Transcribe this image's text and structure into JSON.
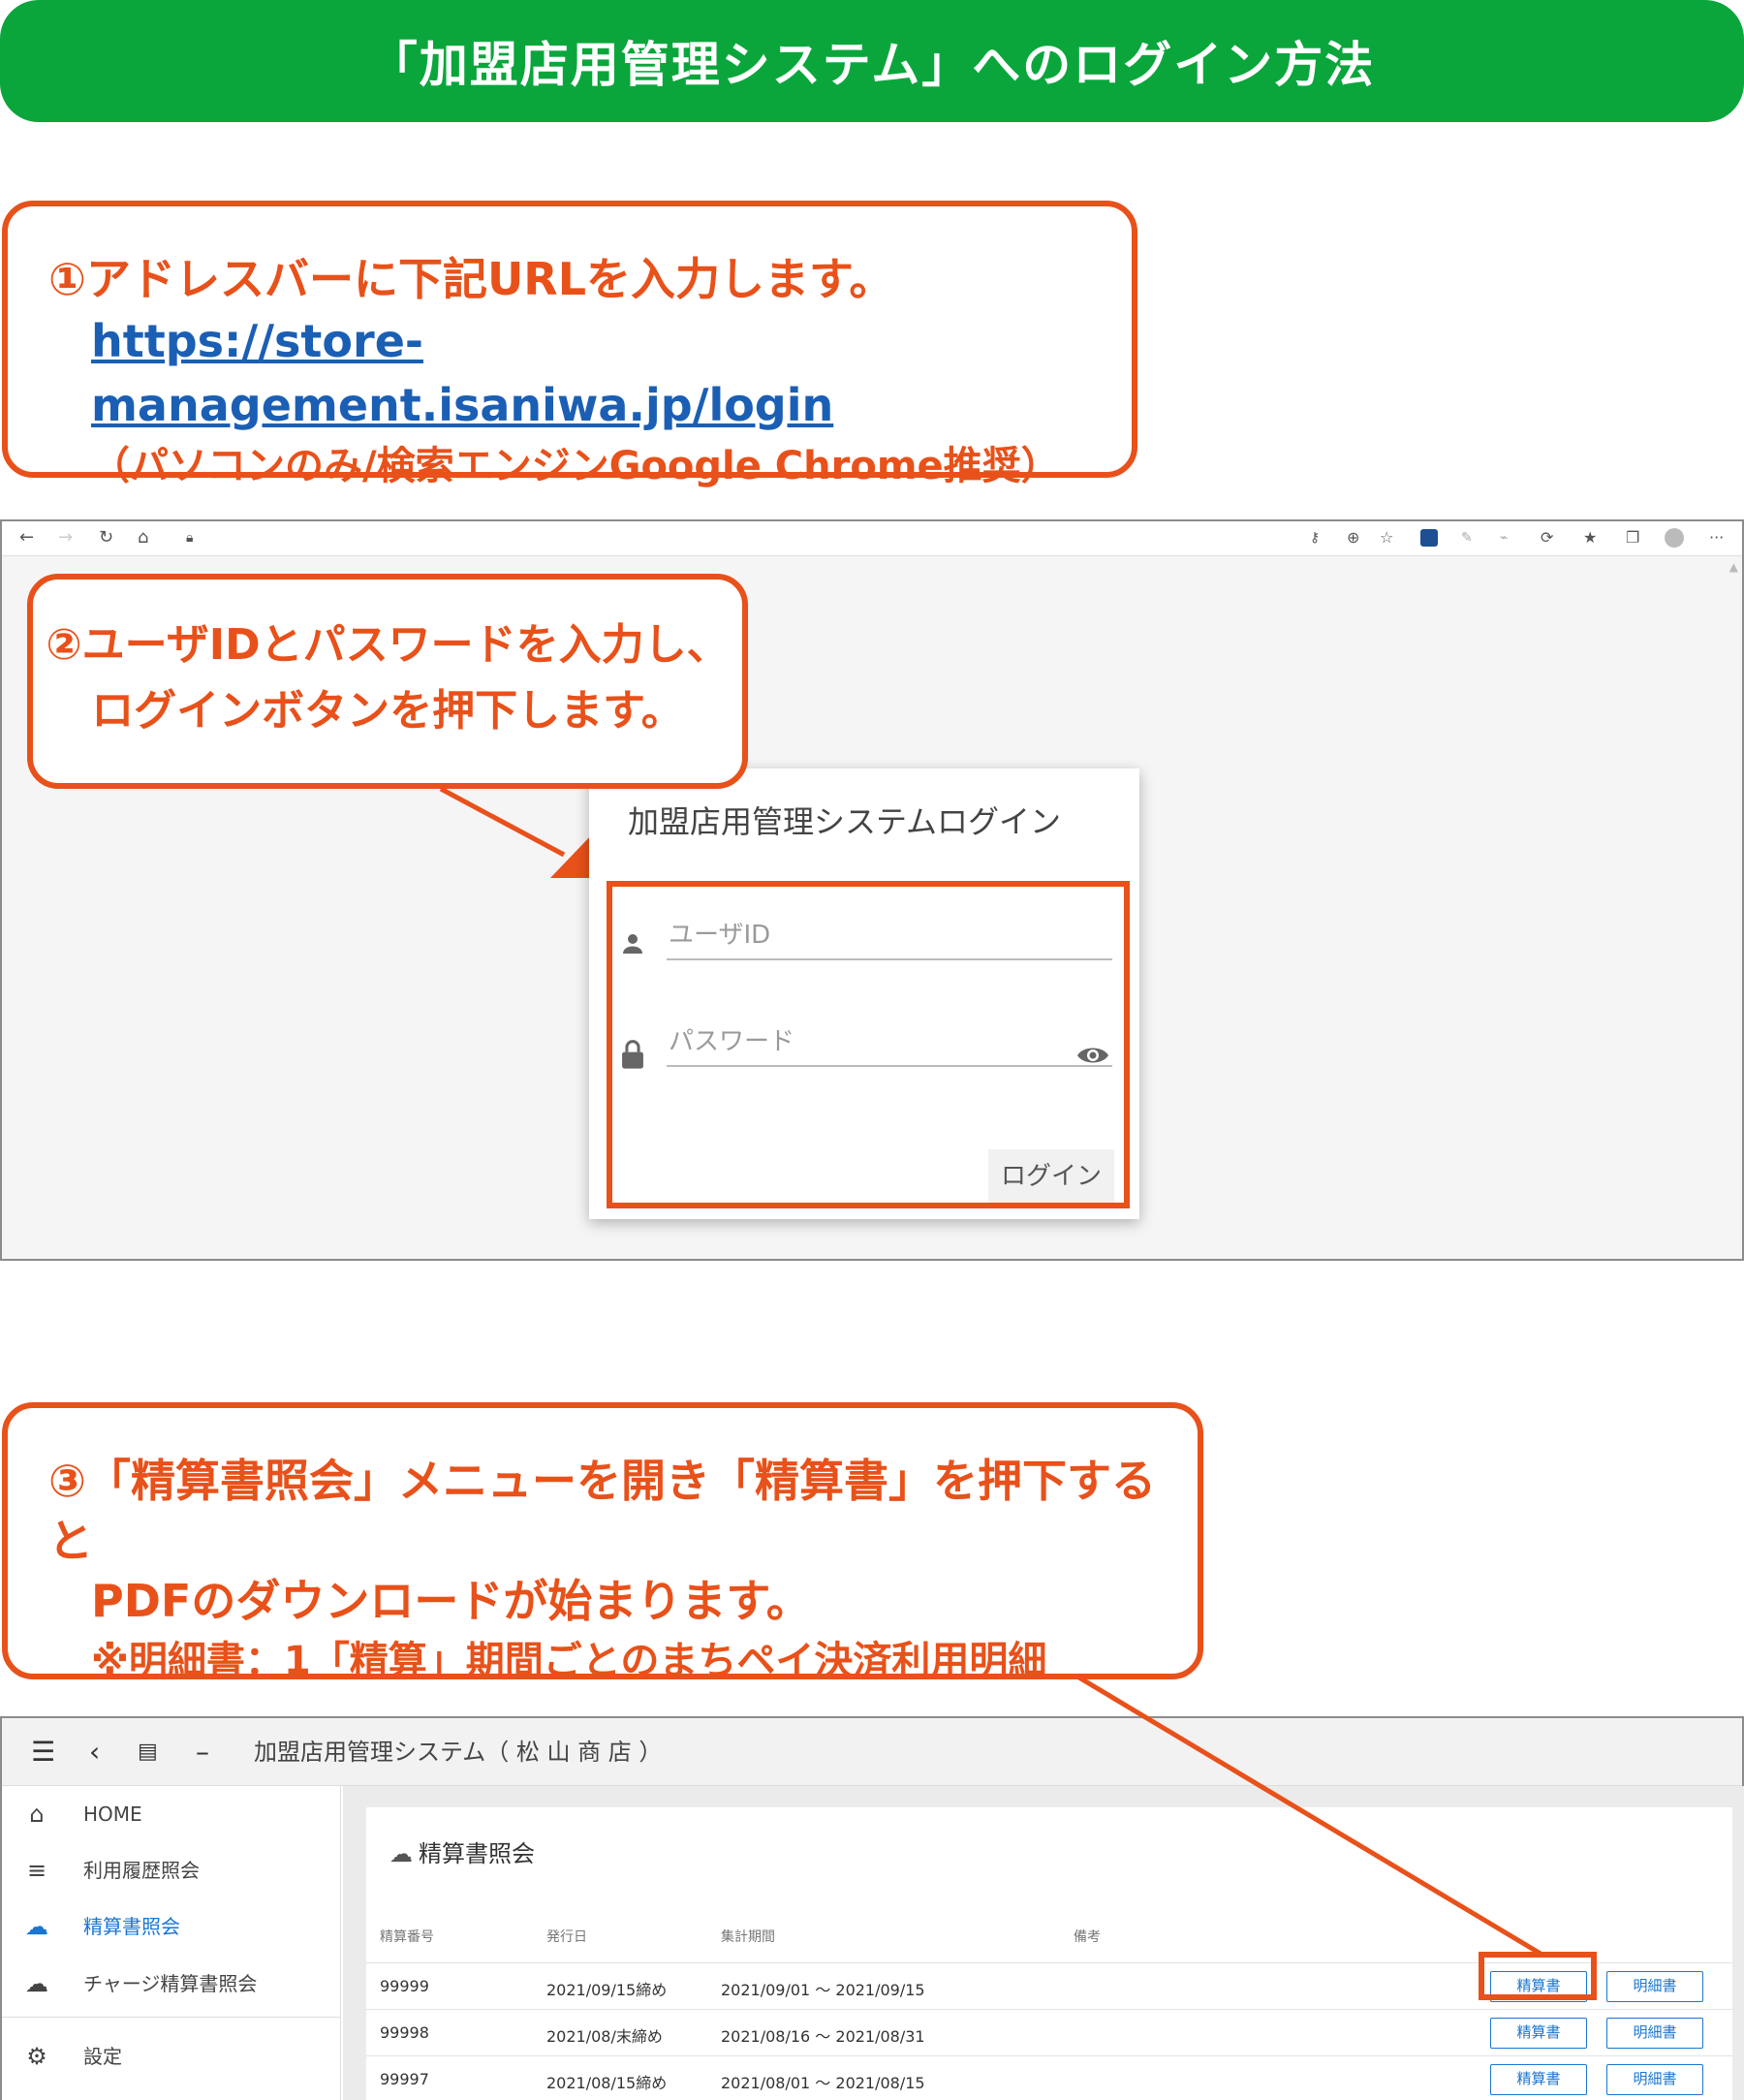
{
  "banner": {
    "title": "「加盟店用管理システム」へのログイン方法"
  },
  "step1": {
    "line1": "①アドレスバーに下記URLを入力します。",
    "url": "https://store-management.isaniwa.jp/login",
    "note": "（パソコンのみ/検索エンジンGoogle Chrome推奨）"
  },
  "step2": {
    "line1": "②ユーザIDとパスワードを入力し、",
    "line2": "ログインボタンを押下します。"
  },
  "login": {
    "title": "加盟店用管理システムログイン",
    "user_placeholder": "ユーザID",
    "password_placeholder": "パスワード",
    "login_button": "ログイン"
  },
  "step3": {
    "line1": "③「精算書照会」メニューを開き「精算書」を押下すると",
    "line2": "PDFのダウンロードが始まります。",
    "line3": "※明細書：1「精算」期間ごとのまちペイ決済利用明細"
  },
  "app": {
    "title": "加盟店用管理システム（ 松 山 商 店 ）",
    "sidebar": [
      {
        "label": "HOME",
        "icon": "home-icon"
      },
      {
        "label": "利用履歴照会",
        "icon": "list-icon"
      },
      {
        "label": "精算書照会",
        "icon": "cloud-download-icon"
      },
      {
        "label": "チャージ精算書照会",
        "icon": "cloud-download-icon"
      },
      {
        "label": "設定",
        "icon": "gear-icon"
      }
    ],
    "panel_title": "精算書照会",
    "table": {
      "headers": [
        "精算番号",
        "発行日",
        "集計期間",
        "備考"
      ],
      "rows": [
        {
          "no": "99999",
          "date": "2021/09/15締め",
          "period": "2021/09/01 ～ 2021/09/15"
        },
        {
          "no": "99998",
          "date": "2021/08/末締め",
          "period": "2021/08/16 ～ 2021/08/31"
        },
        {
          "no": "99997",
          "date": "2021/08/15締め",
          "period": "2021/08/01 ～ 2021/08/15"
        }
      ],
      "btn_statement": "精算書",
      "btn_detail": "明細書"
    }
  },
  "colors": {
    "green": "#0aa63c",
    "orange": "#e8511a",
    "link": "#1b5fb4",
    "accent": "#1976d2"
  }
}
